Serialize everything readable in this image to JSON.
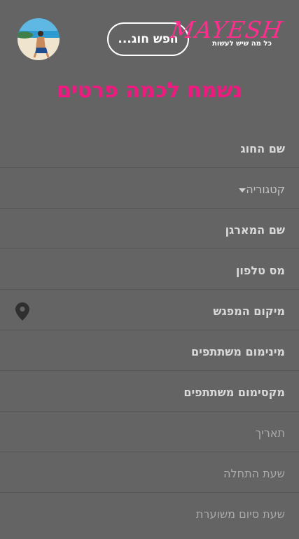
{
  "header": {
    "search_label": "חפש חוג...",
    "logo_text": "MAYESH",
    "logo_tagline": "כל מה שיש לעשות"
  },
  "title": "נשמח לכמה פרטים",
  "form": {
    "fields": [
      {
        "label": "שם החוג"
      },
      {
        "label": "קטגוריה"
      },
      {
        "label": "שם המארגן"
      },
      {
        "label": "מס טלפון"
      },
      {
        "label": "מיקום המפגש"
      },
      {
        "label": "מינימום משתתפים"
      },
      {
        "label": "מקסימום משתתפים"
      },
      {
        "label": "תאריך"
      },
      {
        "label": "שעת התחלה"
      },
      {
        "label": "שעת סיום משוערת"
      }
    ]
  },
  "colors": {
    "background": "#646464",
    "accent": "#ef1a80",
    "logo_pink": "#ff2d8e"
  },
  "icons": [
    "location-pin-icon",
    "chevron-down-icon",
    "avatar"
  ]
}
